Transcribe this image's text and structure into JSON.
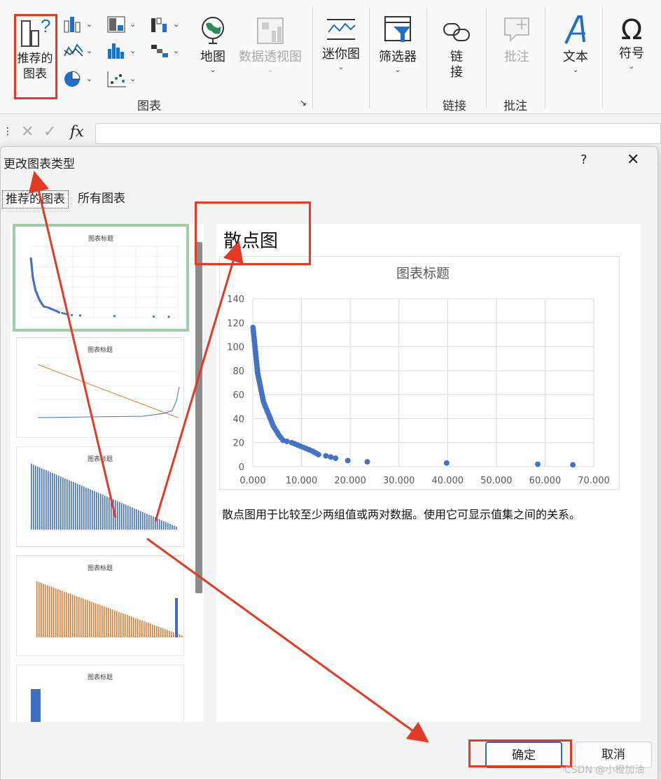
{
  "ribbon": {
    "recommended_charts": "推荐的\n图表",
    "maps": "地图",
    "pivot_chart": "数据透视图",
    "charts_group": "图表",
    "sparklines": "迷你图",
    "filters": "筛选器",
    "link": "链\n接",
    "link_group": "链接",
    "comment": "批注",
    "comment_group": "批注",
    "text": "文本",
    "symbols": "符号"
  },
  "formula_bar": {
    "fx": "fx"
  },
  "dialog": {
    "title": "更改图表类型",
    "help": "?",
    "close": "✕",
    "tabs": [
      "推荐的图表",
      "所有图表"
    ],
    "selected_type": "散点图",
    "description": "散点图用于比较至少两组值或两对数据。使用它可显示值集之间的关系。",
    "ok": "确定",
    "cancel": "取消"
  },
  "thumbnails": [
    {
      "title": "图表标题",
      "kind": "scatter"
    },
    {
      "title": "图表标题",
      "kind": "line-combo"
    },
    {
      "title": "图表标题",
      "kind": "column-blue"
    },
    {
      "title": "图表标题",
      "kind": "column-orange"
    },
    {
      "title": "图表标题",
      "kind": "column-single"
    }
  ],
  "chart_data": {
    "type": "scatter",
    "title": "图表标题",
    "xlim": [
      0,
      70
    ],
    "ylim": [
      0,
      140
    ],
    "xticks": [
      "0.000",
      "10.000",
      "20.000",
      "30.000",
      "40.000",
      "50.000",
      "60.000",
      "70.000"
    ],
    "yticks": [
      "0",
      "20",
      "40",
      "60",
      "80",
      "100",
      "120",
      "140"
    ],
    "grid": true,
    "points": [
      [
        0.05,
        116
      ],
      [
        0.1,
        114
      ],
      [
        0.15,
        112
      ],
      [
        0.2,
        110
      ],
      [
        0.25,
        108
      ],
      [
        0.3,
        106
      ],
      [
        0.35,
        104
      ],
      [
        0.4,
        102
      ],
      [
        0.45,
        100
      ],
      [
        0.5,
        98
      ],
      [
        0.55,
        96
      ],
      [
        0.6,
        94
      ],
      [
        0.65,
        92
      ],
      [
        0.7,
        90
      ],
      [
        0.75,
        88
      ],
      [
        0.8,
        86
      ],
      [
        0.85,
        84
      ],
      [
        0.9,
        82
      ],
      [
        0.95,
        80
      ],
      [
        1.0,
        78
      ],
      [
        1.1,
        76
      ],
      [
        1.2,
        74
      ],
      [
        1.3,
        72
      ],
      [
        1.4,
        70
      ],
      [
        1.5,
        68
      ],
      [
        1.6,
        66
      ],
      [
        1.7,
        64
      ],
      [
        1.8,
        62
      ],
      [
        1.9,
        60
      ],
      [
        2.0,
        58
      ],
      [
        2.1,
        56
      ],
      [
        2.2,
        54
      ],
      [
        2.4,
        52
      ],
      [
        2.6,
        50
      ],
      [
        2.8,
        48
      ],
      [
        3.0,
        46
      ],
      [
        3.2,
        44
      ],
      [
        3.4,
        42
      ],
      [
        3.6,
        40
      ],
      [
        3.8,
        38
      ],
      [
        4.0,
        36
      ],
      [
        4.2,
        34
      ],
      [
        4.5,
        32
      ],
      [
        4.8,
        30
      ],
      [
        5.1,
        28
      ],
      [
        5.4,
        26
      ],
      [
        5.8,
        24
      ],
      [
        6.2,
        22
      ],
      [
        7.0,
        21
      ],
      [
        8.0,
        20
      ],
      [
        8.6,
        19
      ],
      [
        9.2,
        18
      ],
      [
        9.8,
        17
      ],
      [
        10.4,
        16
      ],
      [
        11.0,
        15
      ],
      [
        11.6,
        14
      ],
      [
        12.2,
        13
      ],
      [
        12.6,
        12
      ],
      [
        13.1,
        11
      ],
      [
        13.5,
        10
      ],
      [
        15.0,
        9
      ],
      [
        16.0,
        8
      ],
      [
        17.0,
        7
      ],
      [
        19.5,
        5
      ],
      [
        23.5,
        4
      ],
      [
        39.8,
        3
      ],
      [
        58.5,
        2
      ],
      [
        65.7,
        1.5
      ]
    ]
  },
  "watermark": "CSDN @小橙加油"
}
